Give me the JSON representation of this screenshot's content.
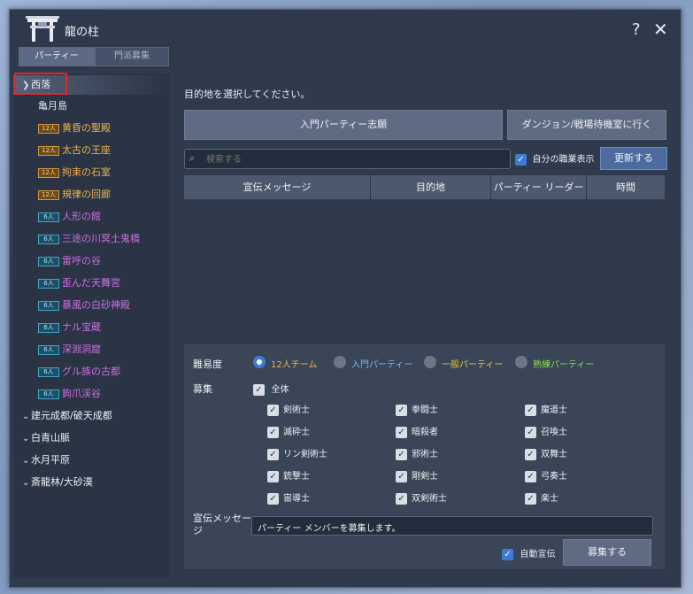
{
  "window": {
    "title": "龍の柱",
    "help": "?",
    "close": "✕"
  },
  "tabs": [
    "パーティー",
    "門派募集"
  ],
  "sidebar": {
    "selected_region": "西落",
    "city": "亀月島",
    "dungeons": [
      {
        "size": "12人",
        "name": "黄昏の聖殿",
        "type": "12"
      },
      {
        "size": "12人",
        "name": "太古の王座",
        "type": "12"
      },
      {
        "size": "12人",
        "name": "拘束の石室",
        "type": "12"
      },
      {
        "size": "12人",
        "name": "規律の回廊",
        "type": "12"
      },
      {
        "size": "6人",
        "name": "人形の館",
        "type": "6"
      },
      {
        "size": "6人",
        "name": "三途の川冥土鬼橋",
        "type": "6"
      },
      {
        "size": "6人",
        "name": "雷呼の谷",
        "type": "6"
      },
      {
        "size": "6人",
        "name": "歪んだ天舞宮",
        "type": "6"
      },
      {
        "size": "6人",
        "name": "暴風の白砂神殿",
        "type": "6"
      },
      {
        "size": "6人",
        "name": "ナル宝蔵",
        "type": "6"
      },
      {
        "size": "6人",
        "name": "深淵洞窟",
        "type": "6"
      },
      {
        "size": "6人",
        "name": "グル族の古都",
        "type": "6"
      },
      {
        "size": "6人",
        "name": "鉤爪渓谷",
        "type": "6"
      }
    ],
    "regions": [
      "建元成都/破天成都",
      "白青山脈",
      "水月平原",
      "斎龍林/大砂漠"
    ]
  },
  "main": {
    "prompt": "目的地を選択してください。",
    "btn_beginner": "入門パーティー志願",
    "btn_dungeon": "ダンジョン/戦場待機室に行く",
    "search_placeholder": "検索する",
    "own_job_label": "自分の職業表示",
    "update": "更新する",
    "headers": [
      "宣伝メッセージ",
      "目的地",
      "パーティー リーダー",
      "時間"
    ]
  },
  "form": {
    "difficulty_label": "難易度",
    "difficulty": [
      {
        "label": "12人チーム",
        "color": "#f0b24a",
        "selected": true
      },
      {
        "label": "入門パーティー",
        "color": "#6fb6ff",
        "selected": false
      },
      {
        "label": "一般パーティー",
        "color": "#f0c040",
        "selected": false
      },
      {
        "label": "熟練パーティー",
        "color": "#8be04a",
        "selected": false
      }
    ],
    "recruit_label": "募集",
    "all_label": "全体",
    "jobs": [
      "剣術士",
      "拳闘士",
      "魔道士",
      "滅砕士",
      "暗殺者",
      "召喚士",
      "リン剣術士",
      "邪術士",
      "双舞士",
      "銃撃士",
      "剛剣士",
      "弓奏士",
      "宙導士",
      "双剣術士",
      "楽士"
    ],
    "message_label": "宣伝メッセージ",
    "message_value": "パーティー メンバーを募集します。",
    "auto_label": "自動宣伝",
    "recruit_button": "募集する"
  }
}
